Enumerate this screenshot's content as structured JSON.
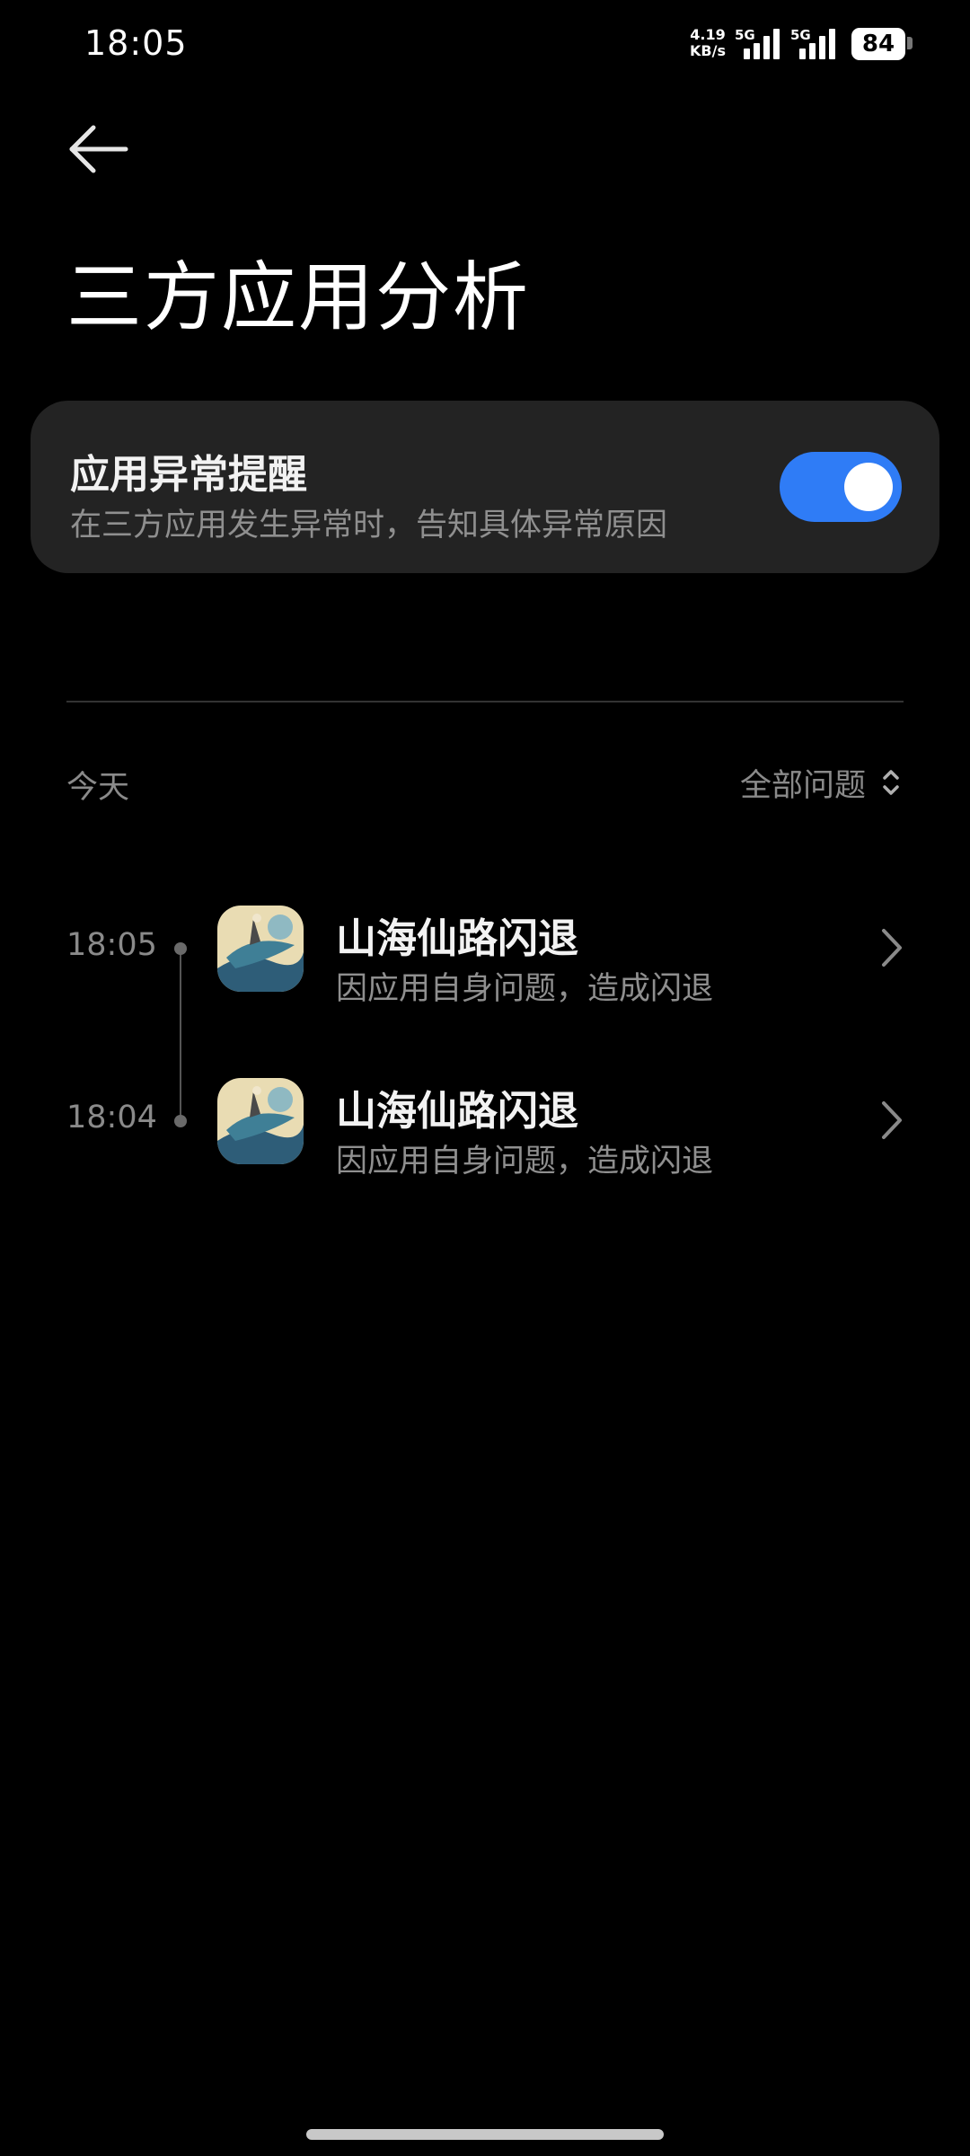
{
  "status_bar": {
    "time": "18:05",
    "net_speed_value": "4.19",
    "net_speed_unit": "KB/s",
    "sim1_label": "5G",
    "sim2_label": "5G",
    "battery": "84",
    "icons": [
      "signal-icon",
      "signal-icon",
      "battery-icon"
    ]
  },
  "header": {
    "back_icon": "arrow-left-icon",
    "title": "三方应用分析"
  },
  "alert_setting": {
    "title": "应用异常提醒",
    "subtitle": "在三方应用发生异常时，告知具体异常原因",
    "enabled": true,
    "accent_color": "#2f7cf6"
  },
  "list": {
    "section_label": "今天",
    "filter_label": "全部问题",
    "filter_icon": "up-down-chevron-icon",
    "entries": [
      {
        "time": "18:05",
        "title": "山海仙路闪退",
        "subtitle": "因应用自身问题，造成闪退",
        "icon": "app-icon"
      },
      {
        "time": "18:04",
        "title": "山海仙路闪退",
        "subtitle": "因应用自身问题，造成闪退",
        "icon": "app-icon"
      }
    ]
  }
}
